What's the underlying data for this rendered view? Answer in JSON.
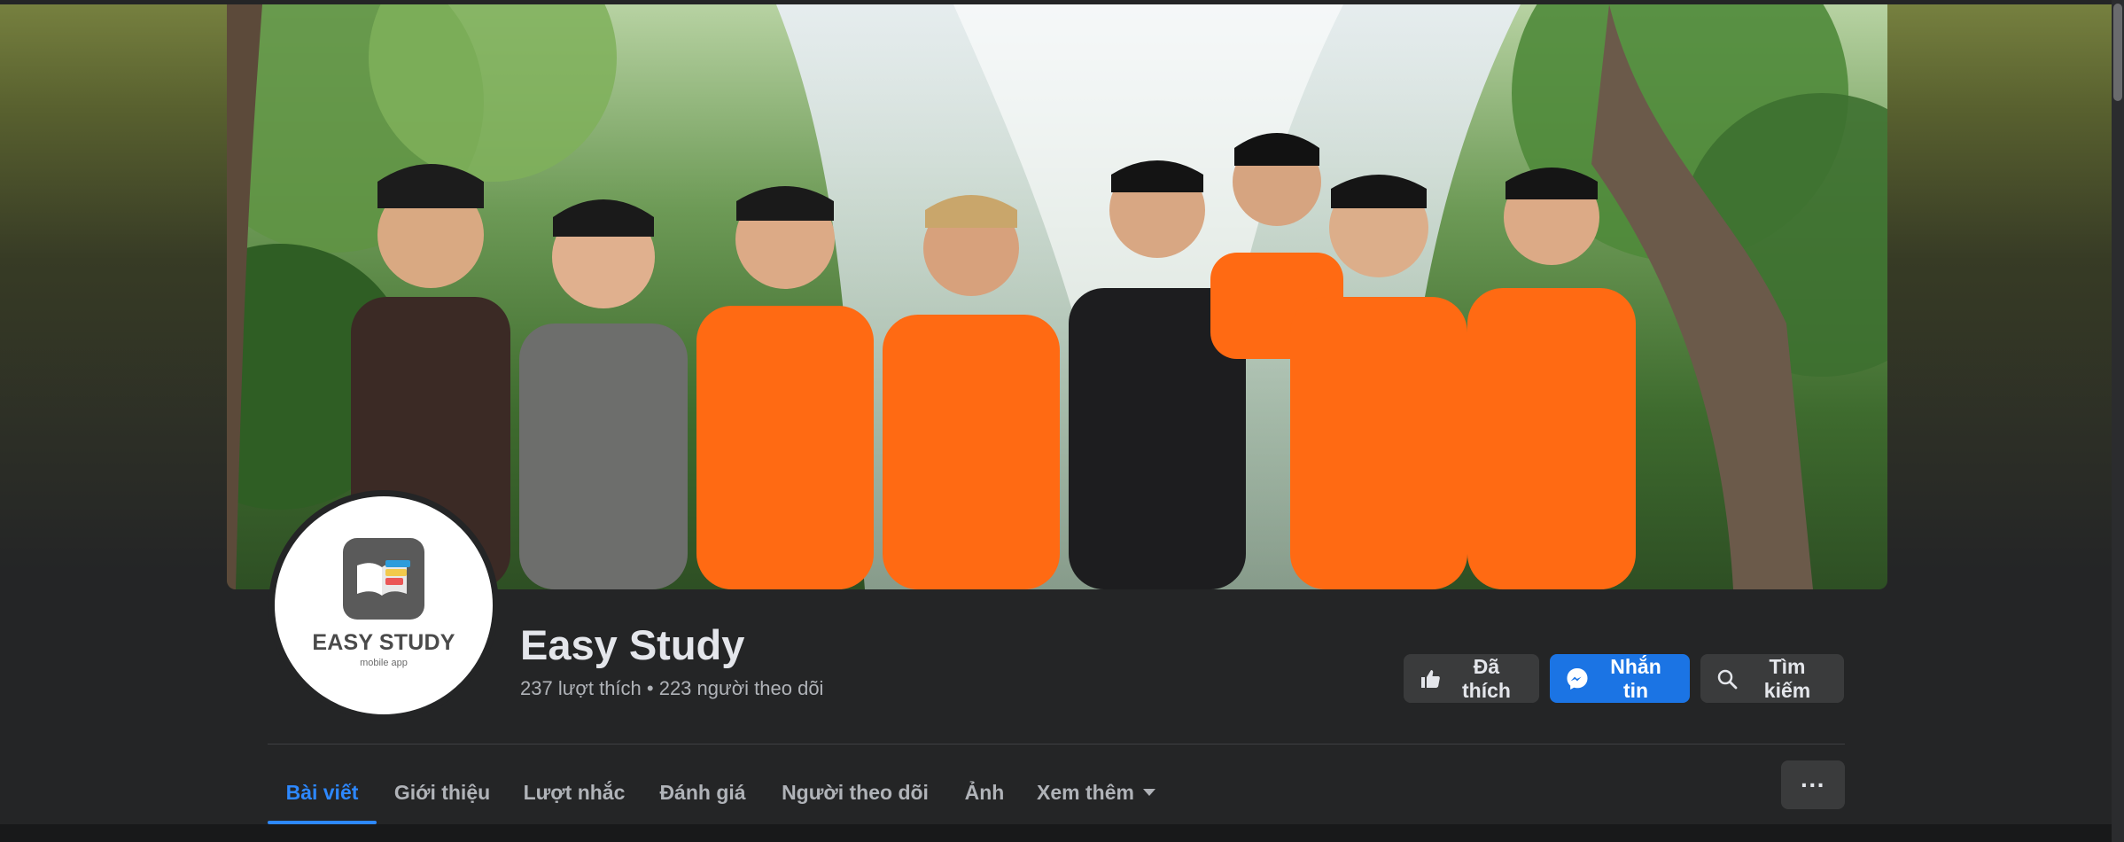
{
  "page": {
    "name": "Easy Study",
    "stats": "237 lượt thích • 223 người theo dõi"
  },
  "avatar": {
    "brand_name": "EASY STUDY",
    "brand_tagline": "mobile app"
  },
  "actions": {
    "liked_label": "Đã thích",
    "message_label": "Nhắn tin",
    "search_label": "Tìm kiếm",
    "liked_icon": "thumbs-up-icon",
    "message_icon": "messenger-icon",
    "search_icon": "search-icon",
    "message_color": "#1b74e4"
  },
  "tabs": [
    {
      "label": "Bài viết",
      "active": true
    },
    {
      "label": "Giới thiệu",
      "active": false
    },
    {
      "label": "Lượt nhắc",
      "active": false
    },
    {
      "label": "Đánh giá",
      "active": false
    },
    {
      "label": "Người theo dõi",
      "active": false
    },
    {
      "label": "Ảnh",
      "active": false
    },
    {
      "label": "Xem thêm",
      "active": false
    }
  ],
  "more_options": "···",
  "colors": {
    "accent": "#2d88ff",
    "background": "#242526",
    "secondary_button": "#3a3b3c"
  }
}
